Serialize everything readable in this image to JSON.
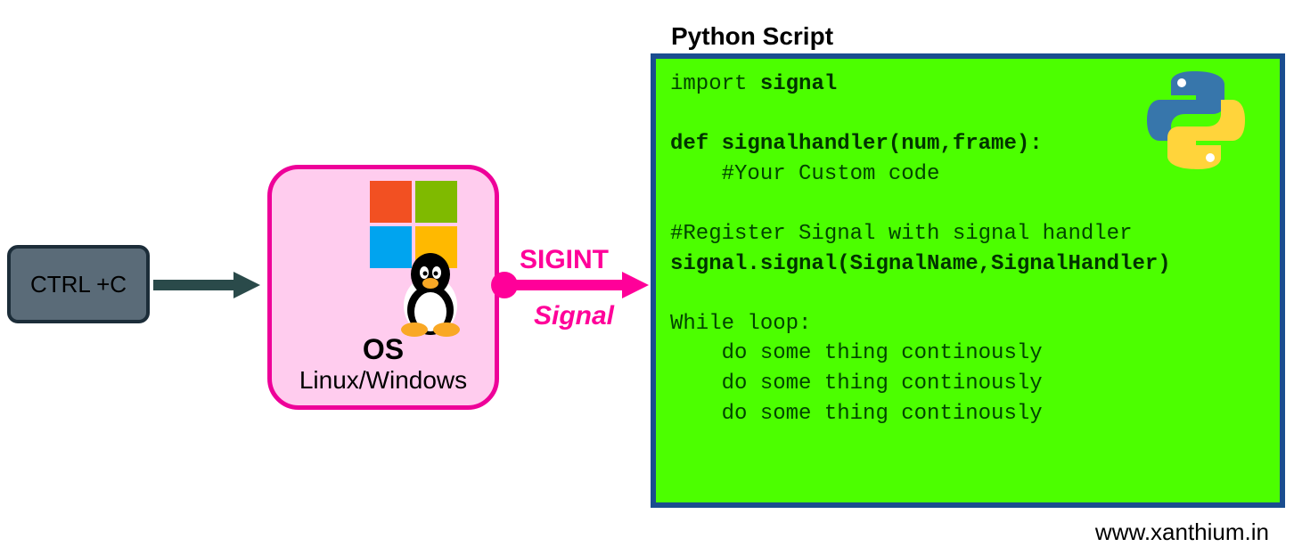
{
  "ctrl_box": {
    "label": "CTRL +C"
  },
  "os_box": {
    "title": "OS",
    "subtitle": "Linux/Windows"
  },
  "signal": {
    "name": "SIGINT",
    "label": "Signal"
  },
  "script": {
    "title": "Python Script",
    "code": {
      "l1a": "import ",
      "l1b": "signal",
      "l3": "def signalhandler(num,frame):",
      "l4": "    #Your Custom code",
      "l6": "#Register Signal with signal handler",
      "l7": "signal.signal(SignalName,SignalHandler)",
      "l9": "While loop:",
      "l10": "    do some thing continously",
      "l11": "    do some thing continously",
      "l12": "    do some thing continously"
    }
  },
  "footer": "www.xanthium.in"
}
